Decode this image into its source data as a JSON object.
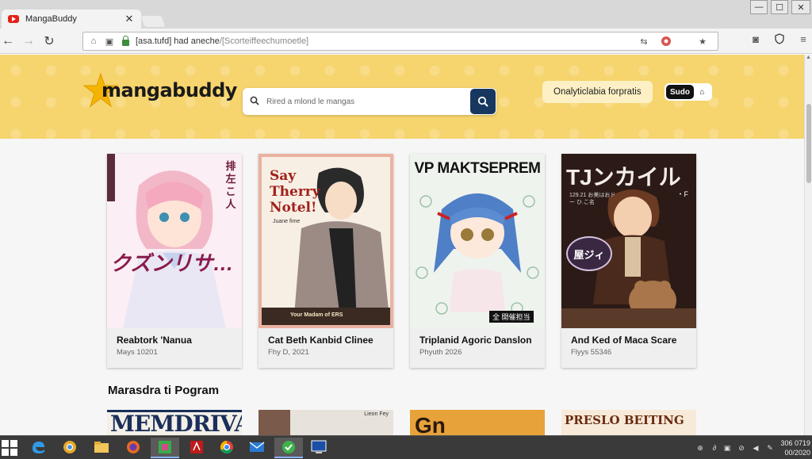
{
  "browser": {
    "tab_title": "MangaBuddy",
    "tab_close": "✕",
    "url": "[asa.tufd] had aneche",
    "url_path": "/[Scorteiffeechumoetle]",
    "back": "←",
    "forward": "→",
    "reload": "↻"
  },
  "site": {
    "logo_text": "mangabuddy",
    "search_placeholder": "Rired a mlond le mangas",
    "header_link": "Onalyticlabia forpratis",
    "header_button": "Sudo"
  },
  "cards": [
    {
      "title": "Reabtork 'Nanua",
      "meta": "Mays 10201"
    },
    {
      "title": "Cat Beth Kanbid Clinee",
      "meta": "Fhy D, 2021"
    },
    {
      "title": "Triplanid Agoric Danslon",
      "meta": "Phyuth 2026"
    },
    {
      "title": "And Ked of Maca Scare",
      "meta": "Flyys 55346"
    }
  ],
  "covers": {
    "c1_side": "排 左 こ 人",
    "c1_big": "クズンリサ…",
    "c2_title_1": "Say",
    "c2_title_2": "Therry",
    "c2_title_3": "Notel!",
    "c2_sub": "Juane fime",
    "c2_bottom": "Your Madam of ERS",
    "c3_title": "VP MAKTSEPREM",
    "c3_bottom": "全 開催担当",
    "c4_title": "ΤJンカイル",
    "c4_small": "129.21 お美はおドー ひ.こ名",
    "c4_badge": "屋ジィ",
    "c4_side": "・F"
  },
  "section": {
    "title": "Marasdra ti Pogram",
    "thumbs": [
      "MEMDRIVA",
      "Lieon Fey",
      "Gn",
      "PRESLO BEITING"
    ]
  },
  "taskbar": {
    "clock_time": "306 0719",
    "clock_date": "00/2020"
  },
  "colors": {
    "header_bg": "#f6d46e",
    "search_button": "#17375e",
    "content_bg": "#f6f6f6"
  }
}
